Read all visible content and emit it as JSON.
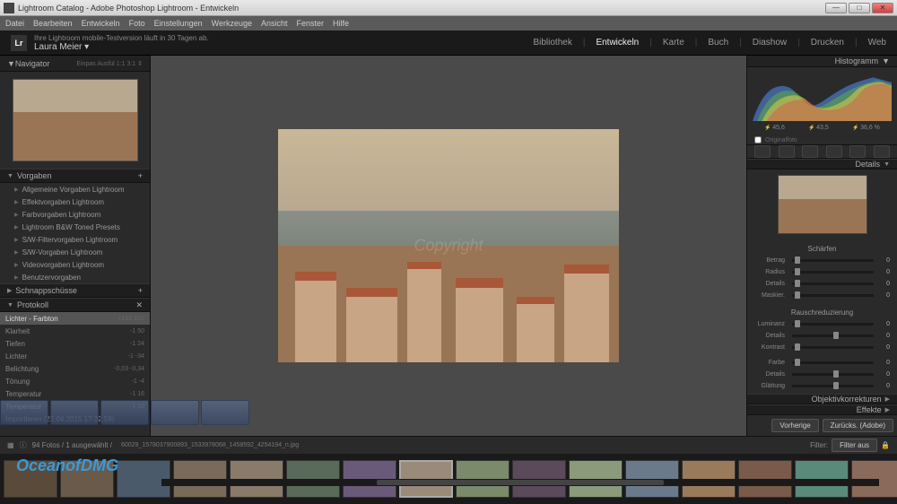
{
  "titlebar": {
    "title": "Lightroom Catalog - Adobe Photoshop Lightroom - Entwickeln"
  },
  "menubar": [
    "Datei",
    "Bearbeiten",
    "Entwickeln",
    "Foto",
    "Einstellungen",
    "Werkzeuge",
    "Ansicht",
    "Fenster",
    "Hilfe"
  ],
  "idbar": {
    "trial": "Ihre Lightroom mobile-Testversion läuft in 30 Tagen ab.",
    "user": "Laura Meier  ▾"
  },
  "modules": [
    "Bibliothek",
    "Entwickeln",
    "Karte",
    "Buch",
    "Diashow",
    "Drucken",
    "Web"
  ],
  "active_module": "Entwickeln",
  "navigator": {
    "title": "Navigator",
    "sub": "Einpas   Ausfül   1:1   3:1  ⇕"
  },
  "presets": {
    "title": "Vorgaben",
    "items": [
      "Allgemeine Vorgaben Lightroom",
      "Effektvorgaben Lightroom",
      "Farbvorgaben Lightroom",
      "Lightroom B&W Toned Presets",
      "S/W-Filtervorgaben Lightroom",
      "S/W-Vorgaben Lightroom",
      "Videovorgaben Lightroom",
      "Benutzervorgaben"
    ]
  },
  "snapshots": {
    "title": "Schnappschüsse"
  },
  "history": {
    "title": "Protokoll",
    "items": [
      {
        "label": "Lichter - Farbton",
        "vals": "+102    102",
        "sel": true
      },
      {
        "label": "Klarheit",
        "vals": "-1     50"
      },
      {
        "label": "Tiefen",
        "vals": "-1     24"
      },
      {
        "label": "Lichter",
        "vals": "-1    -34"
      },
      {
        "label": "Belichtung",
        "vals": "-0,03  -0,34"
      },
      {
        "label": "Tönung",
        "vals": "-1     -4"
      },
      {
        "label": "Temperatur",
        "vals": "-1     16"
      },
      {
        "label": "Temperatur",
        "vals": "-1     16"
      },
      {
        "label": "Importieren (22.04.2015 17:32:59)",
        "vals": ""
      }
    ]
  },
  "histogram": {
    "title": "Histogramm",
    "vals": [
      "45,6",
      "43,5",
      "36,6 %"
    ],
    "originalfoto": "Originalfoto"
  },
  "detail": {
    "title": "Details",
    "sharpen": {
      "title": "Schärfen",
      "sliders": [
        {
          "lbl": "Betrag",
          "val": "0",
          "pos": 3
        },
        {
          "lbl": "Radius",
          "val": "0",
          "pos": 3
        },
        {
          "lbl": "Details",
          "val": "0",
          "pos": 3
        },
        {
          "lbl": "Maskier.",
          "val": "0",
          "pos": 3
        }
      ]
    },
    "noise": {
      "title": "Rauschreduzierung",
      "sliders": [
        {
          "lbl": "Luminanz",
          "val": "0",
          "pos": 3
        },
        {
          "lbl": "Details",
          "val": "0",
          "pos": 50
        },
        {
          "lbl": "Kontrast",
          "val": "0",
          "pos": 3
        }
      ]
    },
    "color": {
      "sliders": [
        {
          "lbl": "Farbe",
          "val": "0",
          "pos": 3
        },
        {
          "lbl": "Details",
          "val": "0",
          "pos": 50
        },
        {
          "lbl": "Glättung",
          "val": "0",
          "pos": 50
        }
      ]
    }
  },
  "lens": {
    "title": "Objektivkorrekturen"
  },
  "effects": {
    "title": "Effekte"
  },
  "buttons": {
    "prev": "Vorherige",
    "reset": "Zurücks. (Adobe)"
  },
  "toolbar": {
    "path": "60029_1578037900893_1533978068_1458592_4254194_n.jpg",
    "count": "94 Fotos / 1 ausgewählt /",
    "filter": "Filter:",
    "filteroff": "Filter aus"
  },
  "watermark": "Copyright",
  "site_watermark": "OceanofDMG"
}
